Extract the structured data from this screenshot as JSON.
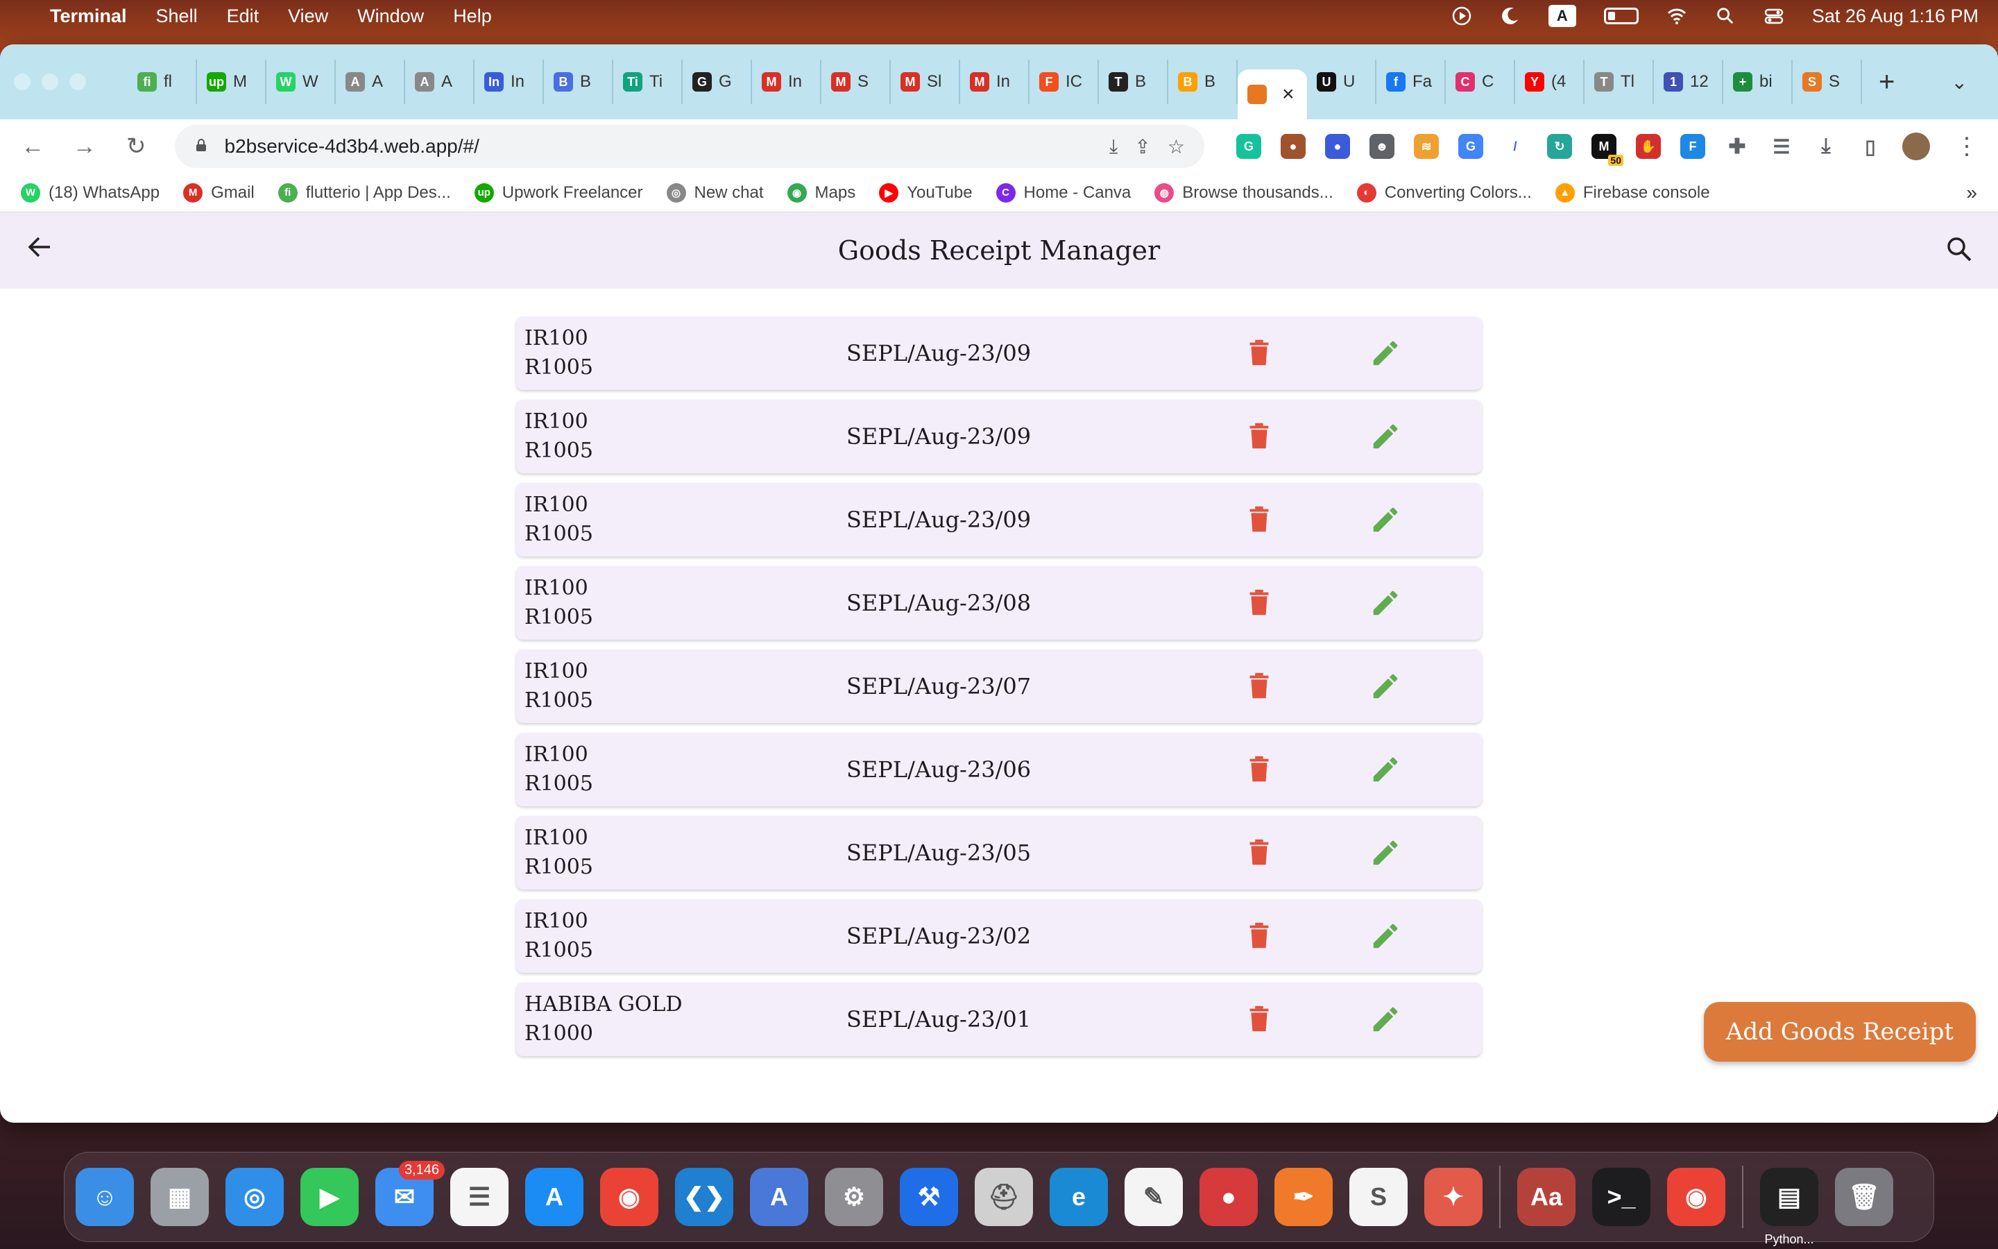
{
  "menubar": {
    "app": "Terminal",
    "items": [
      "Shell",
      "Edit",
      "View",
      "Window",
      "Help"
    ],
    "input_source": "A",
    "datetime": "Sat 26 Aug  1:16 PM"
  },
  "browser": {
    "tabs": [
      {
        "icon": "fi",
        "label": "fl",
        "color": "#4caf50"
      },
      {
        "icon": "up",
        "label": "M",
        "color": "#14a800"
      },
      {
        "icon": "W",
        "label": "W",
        "color": "#25d366"
      },
      {
        "icon": "A",
        "label": "A",
        "color": "#888888"
      },
      {
        "icon": "A",
        "label": "A",
        "color": "#888888"
      },
      {
        "icon": "In",
        "label": "In",
        "color": "#3b5bdb"
      },
      {
        "icon": "B",
        "label": "B",
        "color": "#4a6ee0"
      },
      {
        "icon": "Ti",
        "label": "Ti",
        "color": "#10a37f"
      },
      {
        "icon": "G",
        "label": "G",
        "color": "#222222"
      },
      {
        "icon": "M",
        "label": "In",
        "color": "#d93025"
      },
      {
        "icon": "M",
        "label": "S",
        "color": "#d93025"
      },
      {
        "icon": "M",
        "label": "Sl",
        "color": "#d93025"
      },
      {
        "icon": "M",
        "label": "In",
        "color": "#d93025"
      },
      {
        "icon": "F",
        "label": "IC",
        "color": "#f24e1e"
      },
      {
        "icon": "T",
        "label": "B",
        "color": "#222222"
      },
      {
        "icon": "B",
        "label": "B",
        "color": "#ffa000"
      },
      {
        "icon": "U",
        "label": "U",
        "color": "#111111"
      },
      {
        "icon": "f",
        "label": "Fa",
        "color": "#1877f2"
      },
      {
        "icon": "C",
        "label": "C",
        "color": "#e1306c"
      },
      {
        "icon": "Y",
        "label": "(4",
        "color": "#ff0000"
      },
      {
        "icon": "T",
        "label": "Tl",
        "color": "#888888"
      },
      {
        "icon": "1",
        "label": "12",
        "color": "#3f51b5"
      },
      {
        "icon": "+",
        "label": "bi",
        "color": "#1e8e3e"
      },
      {
        "icon": "S",
        "label": "S",
        "color": "#e87722"
      }
    ],
    "active_tab_close": "×",
    "new_tab": "+",
    "url": "b2bservice-4d3b4.web.app/#/",
    "extension_badge": "50",
    "bookmarks": [
      {
        "label": "(18) WhatsApp",
        "color": "#25d366",
        "icon": "W"
      },
      {
        "label": "Gmail",
        "color": "#d93025",
        "icon": "M"
      },
      {
        "label": "flutterio | App Des...",
        "color": "#4caf50",
        "icon": "fi"
      },
      {
        "label": "Upwork Freelancer",
        "color": "#14a800",
        "icon": "up"
      },
      {
        "label": "New chat",
        "color": "#888888",
        "icon": "◎"
      },
      {
        "label": "Maps",
        "color": "#34a853",
        "icon": "◉"
      },
      {
        "label": "YouTube",
        "color": "#ff0000",
        "icon": "▶"
      },
      {
        "label": "Home - Canva",
        "color": "#7d2ae8",
        "icon": "C"
      },
      {
        "label": "Browse thousands...",
        "color": "#ea4c89",
        "icon": "◍"
      },
      {
        "label": "Converting Colors...",
        "color": "#e53935",
        "icon": "◐"
      },
      {
        "label": "Firebase console",
        "color": "#ffa000",
        "icon": "▲"
      }
    ],
    "bookmarks_more": "»"
  },
  "app": {
    "title": "Goods Receipt Manager",
    "receipts": [
      {
        "party": "IR100",
        "code": "R1005",
        "ref": "SEPL/Aug-23/09"
      },
      {
        "party": "IR100",
        "code": "R1005",
        "ref": "SEPL/Aug-23/09"
      },
      {
        "party": "IR100",
        "code": "R1005",
        "ref": "SEPL/Aug-23/09"
      },
      {
        "party": "IR100",
        "code": "R1005",
        "ref": "SEPL/Aug-23/08"
      },
      {
        "party": "IR100",
        "code": "R1005",
        "ref": "SEPL/Aug-23/07"
      },
      {
        "party": "IR100",
        "code": "R1005",
        "ref": "SEPL/Aug-23/06"
      },
      {
        "party": "IR100",
        "code": "R1005",
        "ref": "SEPL/Aug-23/05"
      },
      {
        "party": "IR100",
        "code": "R1005",
        "ref": "SEPL/Aug-23/02"
      },
      {
        "party": "HABIBA GOLD",
        "code": "R1000",
        "ref": "SEPL/Aug-23/01"
      }
    ],
    "add_button": "Add Goods Receipt",
    "colors": {
      "delete": "#e0523c",
      "edit": "#5fad4e",
      "fab": "#dc7a3c",
      "card": "#f3eefa"
    }
  },
  "dock": {
    "apps": [
      {
        "name": "finder-icon",
        "color": "#3a8ee6",
        "glyph": "☺"
      },
      {
        "name": "launchpad-icon",
        "color": "#9aa0a6",
        "glyph": "▦"
      },
      {
        "name": "safari-icon",
        "color": "#2f8fe8",
        "glyph": "◎"
      },
      {
        "name": "facetime-icon",
        "color": "#34c759",
        "glyph": "▶"
      },
      {
        "name": "mail-icon",
        "color": "#3d8ef0",
        "glyph": "✉",
        "badge": "3,146"
      },
      {
        "name": "reminders-icon",
        "color": "#f5f5f5",
        "glyph": "☰"
      },
      {
        "name": "app-store-icon",
        "color": "#1c8cf5",
        "glyph": "A"
      },
      {
        "name": "chrome-icon",
        "color": "#ea4335",
        "glyph": "◉"
      },
      {
        "name": "vscode-icon",
        "color": "#1f7fd1",
        "glyph": "❮❯"
      },
      {
        "name": "instruments-icon",
        "color": "#4a78d8",
        "glyph": "A"
      },
      {
        "name": "system-settings-icon",
        "color": "#8e8e93",
        "glyph": "⚙"
      },
      {
        "name": "xcode-icon",
        "color": "#1f6ee8",
        "glyph": "⚒"
      },
      {
        "name": "disk-utility-icon",
        "color": "#d0d0d0",
        "glyph": "⛑"
      },
      {
        "name": "edge-icon",
        "color": "#1a8ad4",
        "glyph": "e"
      },
      {
        "name": "textedit-icon",
        "color": "#f4f4f4",
        "glyph": "✎"
      },
      {
        "name": "screen-recorder-icon",
        "color": "#d63a3a",
        "glyph": "●"
      },
      {
        "name": "pen-app-icon",
        "color": "#f07a2a",
        "glyph": "✒"
      },
      {
        "name": "scrivener-icon",
        "color": "#f4f4f4",
        "glyph": "S"
      },
      {
        "name": "pixelmator-icon",
        "color": "#e25a4a",
        "glyph": "✦"
      },
      {
        "name": "dictionary-icon",
        "color": "#b5423a",
        "glyph": "Aa"
      },
      {
        "name": "terminal-icon",
        "color": "#1d1d1f",
        "glyph": ">_"
      },
      {
        "name": "chrome-2-icon",
        "color": "#ea4335",
        "glyph": "◉"
      },
      {
        "name": "python-window-icon",
        "color": "#222222",
        "glyph": "▤",
        "label": "Python..."
      },
      {
        "name": "trash-icon",
        "color": "#7a7a80",
        "glyph": "🗑"
      }
    ]
  }
}
